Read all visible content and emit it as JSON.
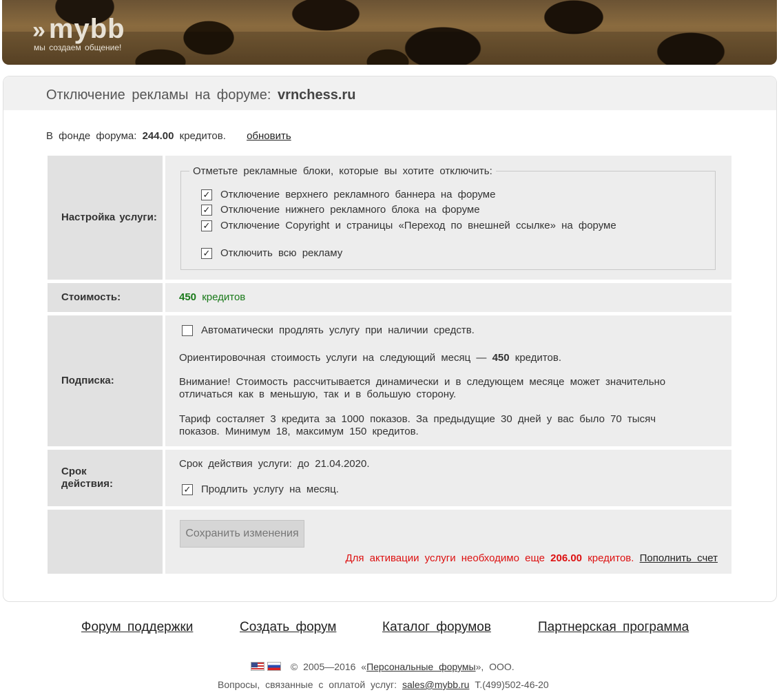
{
  "header": {
    "logo_text": "mybb",
    "logo_arrows": "»",
    "logo_tagline": "мы создаем общение!"
  },
  "page": {
    "title_prefix": "Отключение рекламы на форуме:",
    "forum_name": "vrnchess.ru"
  },
  "fund": {
    "label": "В фонде форума:",
    "amount": "244.00",
    "unit": "кредитов.",
    "refresh_link": "обновить"
  },
  "settings": {
    "label": "Настройка услуги:",
    "legend": "Отметьте рекламные блоки, которые вы хотите отключить:",
    "options": [
      {
        "label": "Отключение верхнего рекламного баннера на форуме",
        "checked": true
      },
      {
        "label": "Отключение нижнего рекламного блока на форуме",
        "checked": true
      },
      {
        "label": "Отключение Copyright и страницы «Переход по внешней ссылке» на форуме",
        "checked": true
      }
    ],
    "disable_all": {
      "label": "Отключить всю рекламу",
      "checked": true
    }
  },
  "cost": {
    "label": "Стоимость:",
    "value": "450",
    "unit": "кредитов"
  },
  "subscription": {
    "label": "Подписка:",
    "auto_renew": {
      "label": "Автоматически продлять услугу при наличии средств.",
      "checked": false
    },
    "estimate_prefix": "Ориентировочная стоимость услуги на следующий месяц —",
    "estimate_value": "450",
    "estimate_unit": "кредитов.",
    "warning": "Внимание! Стоимость рассчитывается динамически и в следующем месяце может значительно отличаться как в меньшую, так и в большую сторону.",
    "tariff": "Тариф состаляет 3 кредита за 1000 показов. За предыдущие 30 дней у вас было 70 тысяч показов. Минимум 18, максимум 150 кредитов."
  },
  "term": {
    "label": "Срок действия:",
    "valid_until": "Срок действия услуги: до 21.04.2020.",
    "extend": {
      "label": "Продлить услугу на месяц.",
      "checked": true
    }
  },
  "actions": {
    "save_button": "Сохранить изменения",
    "activation_prefix": "Для активации услуги необходимо еще",
    "activation_amount": "206.00",
    "activation_unit": "кредитов.",
    "topup_link": "Пополнить счет"
  },
  "footer": {
    "links": [
      "Форум поддержки",
      "Создать форум",
      "Каталог форумов",
      "Партнерская программа"
    ],
    "copyright_prefix": "© 2005—2016 «",
    "company_link": "Персональные форумы",
    "copyright_suffix": "», ООО.",
    "contact_prefix": "Вопросы, связанные с оплатой услуг:",
    "contact_email": "sales@mybb.ru",
    "contact_phone": "Т.(499)502-46-20"
  },
  "colors": {
    "green": "#1a7a1a",
    "red": "#dd1111",
    "label_bg": "#e1e1e1",
    "content_bg": "#ededed"
  }
}
